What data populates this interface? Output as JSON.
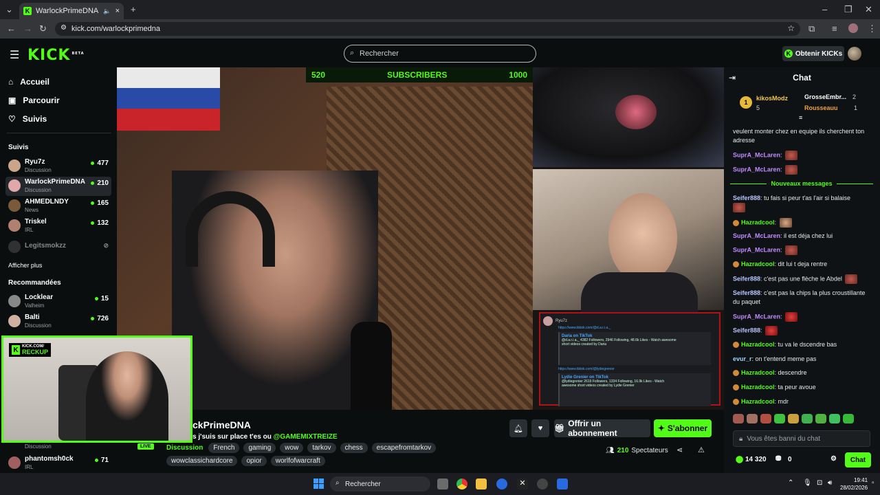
{
  "browser": {
    "tab_title": "WarlockPrimeDNA Stream",
    "url": "kick.com/warlockprimedna"
  },
  "header": {
    "logo": "KICK",
    "logo_beta": "BETA",
    "search_placeholder": "Rechercher",
    "get_kicks_label": "Obtenir KICKs"
  },
  "sidebar": {
    "nav": [
      {
        "label": "Accueil",
        "icon": "home-icon"
      },
      {
        "label": "Parcourir",
        "icon": "browse-icon"
      },
      {
        "label": "Suivis",
        "icon": "heart-icon"
      }
    ],
    "following_title": "Suivis",
    "following": [
      {
        "name": "Ryu7z",
        "category": "Discussion",
        "viewers": "477"
      },
      {
        "name": "WarlockPrimeDNA",
        "category": "Discussion",
        "viewers": "210"
      },
      {
        "name": "AHMEDLNDY",
        "category": "News",
        "viewers": "165"
      },
      {
        "name": "Triskel",
        "category": "IRL",
        "viewers": "132"
      },
      {
        "name": "Legitsmokzz",
        "category": "",
        "viewers": ""
      }
    ],
    "show_more": "Afficher plus",
    "recommended_title": "Recommandées",
    "recommended": [
      {
        "name": "Locklear",
        "category": "Valheim",
        "viewers": "15"
      },
      {
        "name": "Balti",
        "category": "Discussion",
        "viewers": "726"
      },
      {
        "name": "phantomsh0ck",
        "category": "IRL",
        "viewers": "71"
      }
    ],
    "hidden_category": "Discussion"
  },
  "video": {
    "subs_left": "520",
    "subs_label": "SUBSCRIBERS",
    "subs_right": "1000",
    "webcam_badge_top": "KICK.COM/",
    "webcam_badge_bottom": "RECKUP",
    "live_label": "LIVE",
    "tiktok_user": "Ryu7z",
    "tiktok_link1": "https://www.tiktok.com/@d.a.r.i.a._",
    "tiktok_card1_title": "Daria on TikTok",
    "tiktok_card1_text": "@d.a.r.i.a._ 4382 Followers, 2946 Following, 48.6k Likes - Watch awesome short videos created by Daria",
    "tiktok_link2": "https://www.tiktok.com/@lydiegrenier",
    "tiktok_card2_title": "Lydie Grenier on TikTok",
    "tiktok_card2_text": "@lydiegrenier 2619 Followers, 1334 Following, 16.9k Likes - Watch awesome short videos created by Lydie Grenier"
  },
  "stream": {
    "name": "ckPrimeDNA",
    "title_text": "s j'suis sur place t'es ou",
    "title_mention": "@GAMEMIXTREIZE",
    "category": "Discussion",
    "tags": [
      "French",
      "gaming",
      "wow",
      "tarkov",
      "chess",
      "escapefromtarkov",
      "wowclassichardcore",
      "opior",
      "worlfofwarcraft"
    ],
    "gift_label": "Offrir un abonnement",
    "subscribe_label": "S'abonner",
    "viewers_count": "210",
    "viewers_label": "Spectateurs"
  },
  "chat": {
    "title": "Chat",
    "leaderboard": [
      {
        "rank": "1",
        "name": "kikosModz",
        "value": "5"
      },
      {
        "name": "GrosseEmbr...",
        "value": "2"
      },
      {
        "name": "Rousseauu",
        "value": "1"
      }
    ],
    "pre_messages": [
      {
        "user": "",
        "text": "veulent monter chez en equipe ils cherchent ton adresse",
        "color": "#e8e8e8"
      },
      {
        "user": "SuprA_McLaren",
        "text": "",
        "color": "#c08cff"
      },
      {
        "user": "SuprA_McLaren",
        "text": "",
        "color": "#c08cff"
      }
    ],
    "new_messages_label": "Nouveaux messages",
    "messages": [
      {
        "user": "Seifer888",
        "text": "tu fais si peur t'as l'air si balaise",
        "color": "#b8c6ff"
      },
      {
        "user": "Hazradcool",
        "text": "",
        "color": "#53fc18"
      },
      {
        "user": "SuprA_McLaren",
        "text": "il est déja chez lui",
        "color": "#c08cff"
      },
      {
        "user": "SuprA_McLaren",
        "text": "",
        "color": "#c08cff"
      },
      {
        "user": "Hazradcool",
        "text": "dit lui t deja rentre",
        "color": "#53fc18"
      },
      {
        "user": "Seifer888",
        "text": "c'est pas une flèche le Abdel",
        "color": "#b8c6ff"
      },
      {
        "user": "Seifer888",
        "text": "c'est pas la chips la plus croustillante du paquet",
        "color": "#b8c6ff"
      },
      {
        "user": "SuprA_McLaren",
        "text": "",
        "color": "#c08cff"
      },
      {
        "user": "Seifer888",
        "text": "",
        "color": "#b8c6ff"
      },
      {
        "user": "Hazradcool",
        "text": "tu va le dscendre bas",
        "color": "#53fc18"
      },
      {
        "user": "evur_r",
        "text": "on t'entend meme pas",
        "color": "#9fd4ff"
      },
      {
        "user": "Hazradcool",
        "text": "descendre",
        "color": "#53fc18"
      },
      {
        "user": "Hazradcool",
        "text": "ta peur avoue",
        "color": "#53fc18"
      },
      {
        "user": "Hazradcool",
        "text": "mdr",
        "color": "#53fc18"
      }
    ],
    "input_placeholder": "Vous êtes banni du chat",
    "kicks_balance": "14 320",
    "points": "0",
    "chat_button": "Chat"
  },
  "taskbar": {
    "search_placeholder": "Rechercher",
    "time": "19:41",
    "date": "28/02/2026"
  },
  "colors": {
    "kick_green": "#53fc18",
    "background": "#0b0e0f",
    "report_red": "#b0121a"
  }
}
